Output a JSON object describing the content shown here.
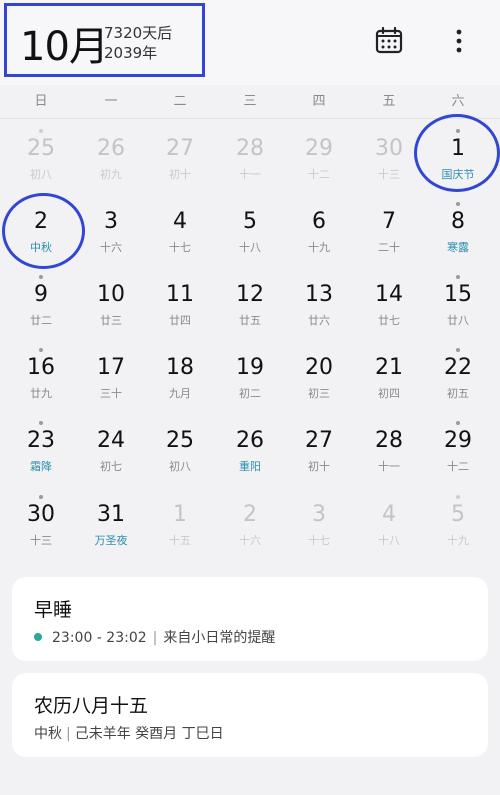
{
  "header": {
    "month": "10月",
    "days_until": "7320天后",
    "year": "2039年"
  },
  "icons": {
    "calendar": "calendar-icon",
    "more": "more-vertical-icon"
  },
  "weekdays": [
    "日",
    "一",
    "二",
    "三",
    "四",
    "五",
    "六"
  ],
  "weeks": [
    [
      {
        "n": "25",
        "l": "初八",
        "dim": true,
        "dot": true
      },
      {
        "n": "26",
        "l": "初九",
        "dim": true,
        "dot": false
      },
      {
        "n": "27",
        "l": "初十",
        "dim": true,
        "dot": false
      },
      {
        "n": "28",
        "l": "十一",
        "dim": true,
        "dot": false
      },
      {
        "n": "29",
        "l": "十二",
        "dim": true,
        "dot": false
      },
      {
        "n": "30",
        "l": "十三",
        "dim": true,
        "dot": false
      },
      {
        "n": "1",
        "l": "国庆节",
        "holiday": true,
        "dot": true
      }
    ],
    [
      {
        "n": "2",
        "l": "中秋",
        "holiday": true,
        "dot": false
      },
      {
        "n": "3",
        "l": "十六",
        "dot": false
      },
      {
        "n": "4",
        "l": "十七",
        "dot": false
      },
      {
        "n": "5",
        "l": "十八",
        "dot": false
      },
      {
        "n": "6",
        "l": "十九",
        "dot": false
      },
      {
        "n": "7",
        "l": "二十",
        "dot": false
      },
      {
        "n": "8",
        "l": "寒露",
        "holiday": true,
        "dot": true
      }
    ],
    [
      {
        "n": "9",
        "l": "廿二",
        "dot": true
      },
      {
        "n": "10",
        "l": "廿三",
        "dot": false
      },
      {
        "n": "11",
        "l": "廿四",
        "dot": false
      },
      {
        "n": "12",
        "l": "廿五",
        "dot": false
      },
      {
        "n": "13",
        "l": "廿六",
        "dot": false
      },
      {
        "n": "14",
        "l": "廿七",
        "dot": false
      },
      {
        "n": "15",
        "l": "廿八",
        "dot": true
      }
    ],
    [
      {
        "n": "16",
        "l": "廿九",
        "dot": true
      },
      {
        "n": "17",
        "l": "三十",
        "dot": false
      },
      {
        "n": "18",
        "l": "九月",
        "dot": false
      },
      {
        "n": "19",
        "l": "初二",
        "dot": false
      },
      {
        "n": "20",
        "l": "初三",
        "dot": false
      },
      {
        "n": "21",
        "l": "初四",
        "dot": false
      },
      {
        "n": "22",
        "l": "初五",
        "dot": true
      }
    ],
    [
      {
        "n": "23",
        "l": "霜降",
        "holiday": true,
        "dot": true
      },
      {
        "n": "24",
        "l": "初七",
        "dot": false
      },
      {
        "n": "25",
        "l": "初八",
        "dot": false
      },
      {
        "n": "26",
        "l": "重阳",
        "holiday": true,
        "dot": false
      },
      {
        "n": "27",
        "l": "初十",
        "dot": false
      },
      {
        "n": "28",
        "l": "十一",
        "dot": false
      },
      {
        "n": "29",
        "l": "十二",
        "dot": true
      }
    ],
    [
      {
        "n": "30",
        "l": "十三",
        "dot": true
      },
      {
        "n": "31",
        "l": "万圣夜",
        "holiday": true,
        "dot": false
      },
      {
        "n": "1",
        "l": "十五",
        "dim": true,
        "dot": false
      },
      {
        "n": "2",
        "l": "十六",
        "dim": true,
        "dot": false
      },
      {
        "n": "3",
        "l": "十七",
        "dim": true,
        "dot": false
      },
      {
        "n": "4",
        "l": "十八",
        "dim": true,
        "dot": false
      },
      {
        "n": "5",
        "l": "十九",
        "dim": true,
        "dot": true
      }
    ]
  ],
  "event_card": {
    "title": "早睡",
    "time": "23:00 - 23:02",
    "separator": "|",
    "source": "来自小日常的提醒"
  },
  "lunar_card": {
    "title": "农历八月十五",
    "festival": "中秋",
    "separator": "|",
    "ganzhi": "己未羊年 癸酉月 丁巳日"
  },
  "colors": {
    "highlight_ring": "#3146d4",
    "holiday_text": "#2a8fb0",
    "event_dot": "#2aa79b"
  }
}
